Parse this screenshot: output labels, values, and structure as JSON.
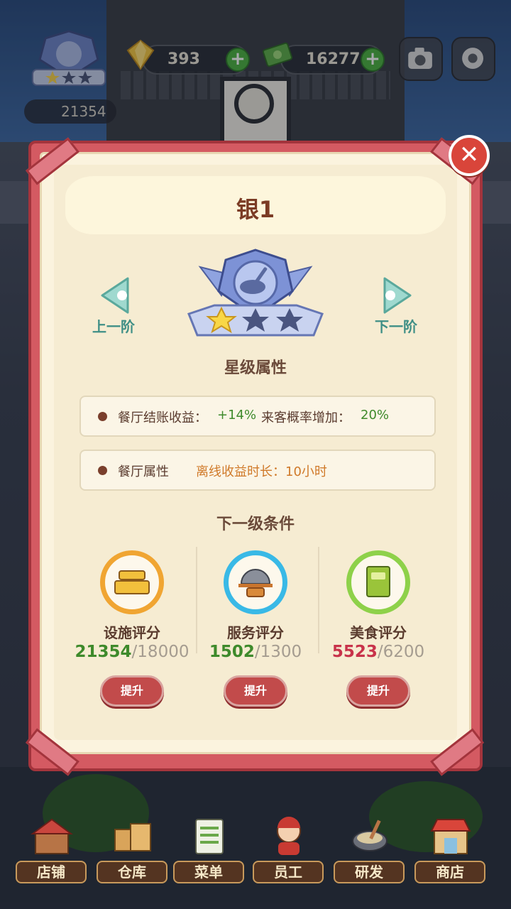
{
  "hud": {
    "gems": "393",
    "cash": "16277",
    "facility_score": "21354"
  },
  "modal": {
    "title": "银1",
    "prev_label": "上一阶",
    "next_label": "下一阶",
    "star_section_title": "星级属性",
    "attributes": {
      "row1_label1": "餐厅结账收益：",
      "row1_value1": "+14%",
      "row1_label2": "来客概率增加：",
      "row1_value2": "20%",
      "row2_label": "餐厅属性",
      "row2_value": "离线收益时长：10小时"
    },
    "next_level_title": "下一级条件",
    "requirements": [
      {
        "label": "设施评分",
        "current": "21354",
        "target": "/18000",
        "button": "提升",
        "ring_color": "#f0a532",
        "current_color": "#3e8a2b"
      },
      {
        "label": "服务评分",
        "current": "1502",
        "target": "/1300",
        "button": "提升",
        "ring_color": "#39b9e6",
        "current_color": "#3e8a2b"
      },
      {
        "label": "美食评分",
        "current": "5523",
        "target": "/6200",
        "button": "提升",
        "ring_color": "#8ed14a",
        "current_color": "#c8324a"
      }
    ],
    "stars_earned": 1,
    "stars_total": 3
  },
  "nav": [
    {
      "label": "店铺",
      "icon": "shop-icon"
    },
    {
      "label": "仓库",
      "icon": "warehouse-icon"
    },
    {
      "label": "菜单",
      "icon": "menu-icon"
    },
    {
      "label": "员工",
      "icon": "staff-icon"
    },
    {
      "label": "研发",
      "icon": "research-icon"
    },
    {
      "label": "商店",
      "icon": "store-icon"
    }
  ]
}
